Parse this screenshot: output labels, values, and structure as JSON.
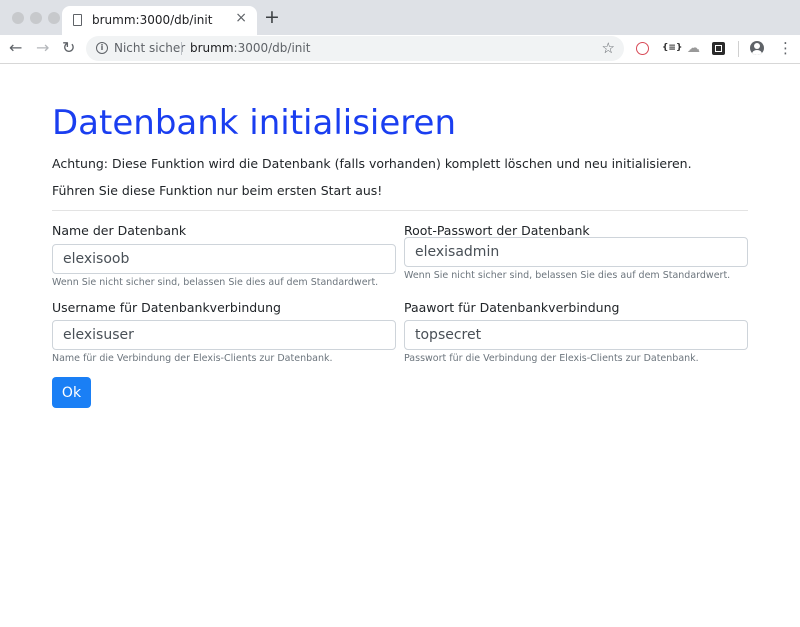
{
  "browser": {
    "tab_title": "brumm:3000/db/init",
    "tab_close": "×",
    "new_tab": "+",
    "security_label": "Nicht sicher",
    "url_host": "brumm",
    "url_rest": ":3000/db/init",
    "nav_back": "←",
    "nav_forward": "→",
    "nav_reload": "↻",
    "bookmark_star": "☆",
    "ext_code_label": "{≡}",
    "menu_dots": "⋮"
  },
  "page": {
    "title": "Datenbank initialisieren",
    "warning": "Achtung: Diese Funktion wird die Datenbank (falls vorhanden) komplett löschen und neu initialisieren.",
    "note": "Führen Sie diese Funktion nur beim ersten Start aus!"
  },
  "form": {
    "db_name": {
      "label": "Name der Datenbank",
      "value": "elexisoob",
      "help": "Wenn Sie nicht sicher sind, belassen Sie dies auf dem Standardwert."
    },
    "root_password": {
      "label": "Root-Passwort der Datenbank",
      "value": "elexisadmin",
      "help": "Wenn Sie nicht sicher sind, belassen Sie dies auf dem Standardwert."
    },
    "username": {
      "label": "Username für Datenbankverbindung",
      "value": "elexisuser",
      "help": "Name für die Verbindung der Elexis-Clients zur Datenbank."
    },
    "password": {
      "label": "Paawort für Datenbankverbindung",
      "value": "topsecret",
      "help": "Passwort für die Verbindung der Elexis-Clients zur Datenbank."
    },
    "submit_label": "Ok"
  },
  "colors": {
    "title": "#1a3ef0",
    "button": "#1a7ff5"
  }
}
